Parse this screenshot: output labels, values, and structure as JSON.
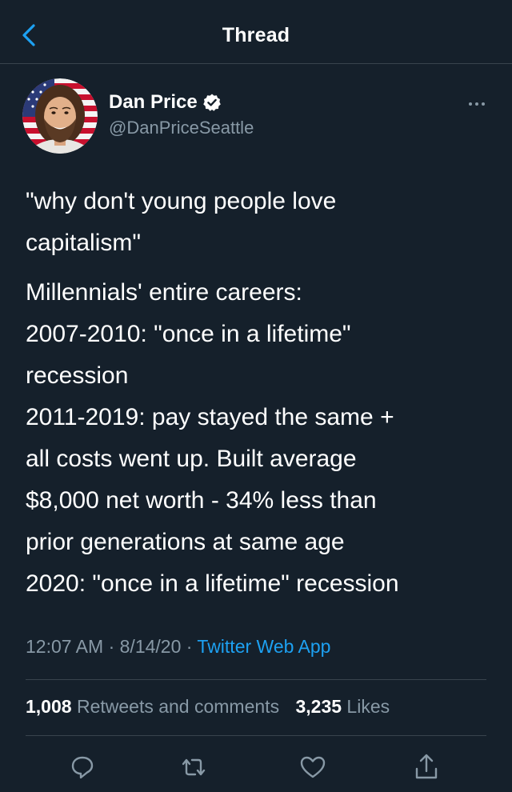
{
  "header": {
    "title": "Thread",
    "back_icon": "chevron-left-icon"
  },
  "user": {
    "name": "Dan Price",
    "handle": "@DanPriceSeattle",
    "verified": true
  },
  "tweet": {
    "lines_p1": [
      "\"why don't young people love",
      "capitalism\""
    ],
    "lines_p2": [
      "Millennials' entire careers:",
      "2007-2010: \"once in a lifetime\"",
      "recession",
      "2011-2019: pay stayed the same +",
      "all costs went up. Built average",
      "$8,000 net worth - 34% less than",
      "prior generations at same age",
      "2020: \"once in a lifetime\" recession"
    ]
  },
  "meta": {
    "time": "12:07 AM",
    "separator": " · ",
    "date": "8/14/20",
    "source": "Twitter Web App"
  },
  "stats": {
    "retweets_count": "1,008",
    "retweets_label": "Retweets and comments",
    "likes_count": "3,235",
    "likes_label": "Likes"
  },
  "actions": [
    "reply-icon",
    "retweet-icon",
    "like-icon",
    "share-icon"
  ],
  "colors": {
    "background": "#15202b",
    "accent": "#1da1f2",
    "secondary_text": "#8899a6",
    "divider": "#38444d"
  }
}
